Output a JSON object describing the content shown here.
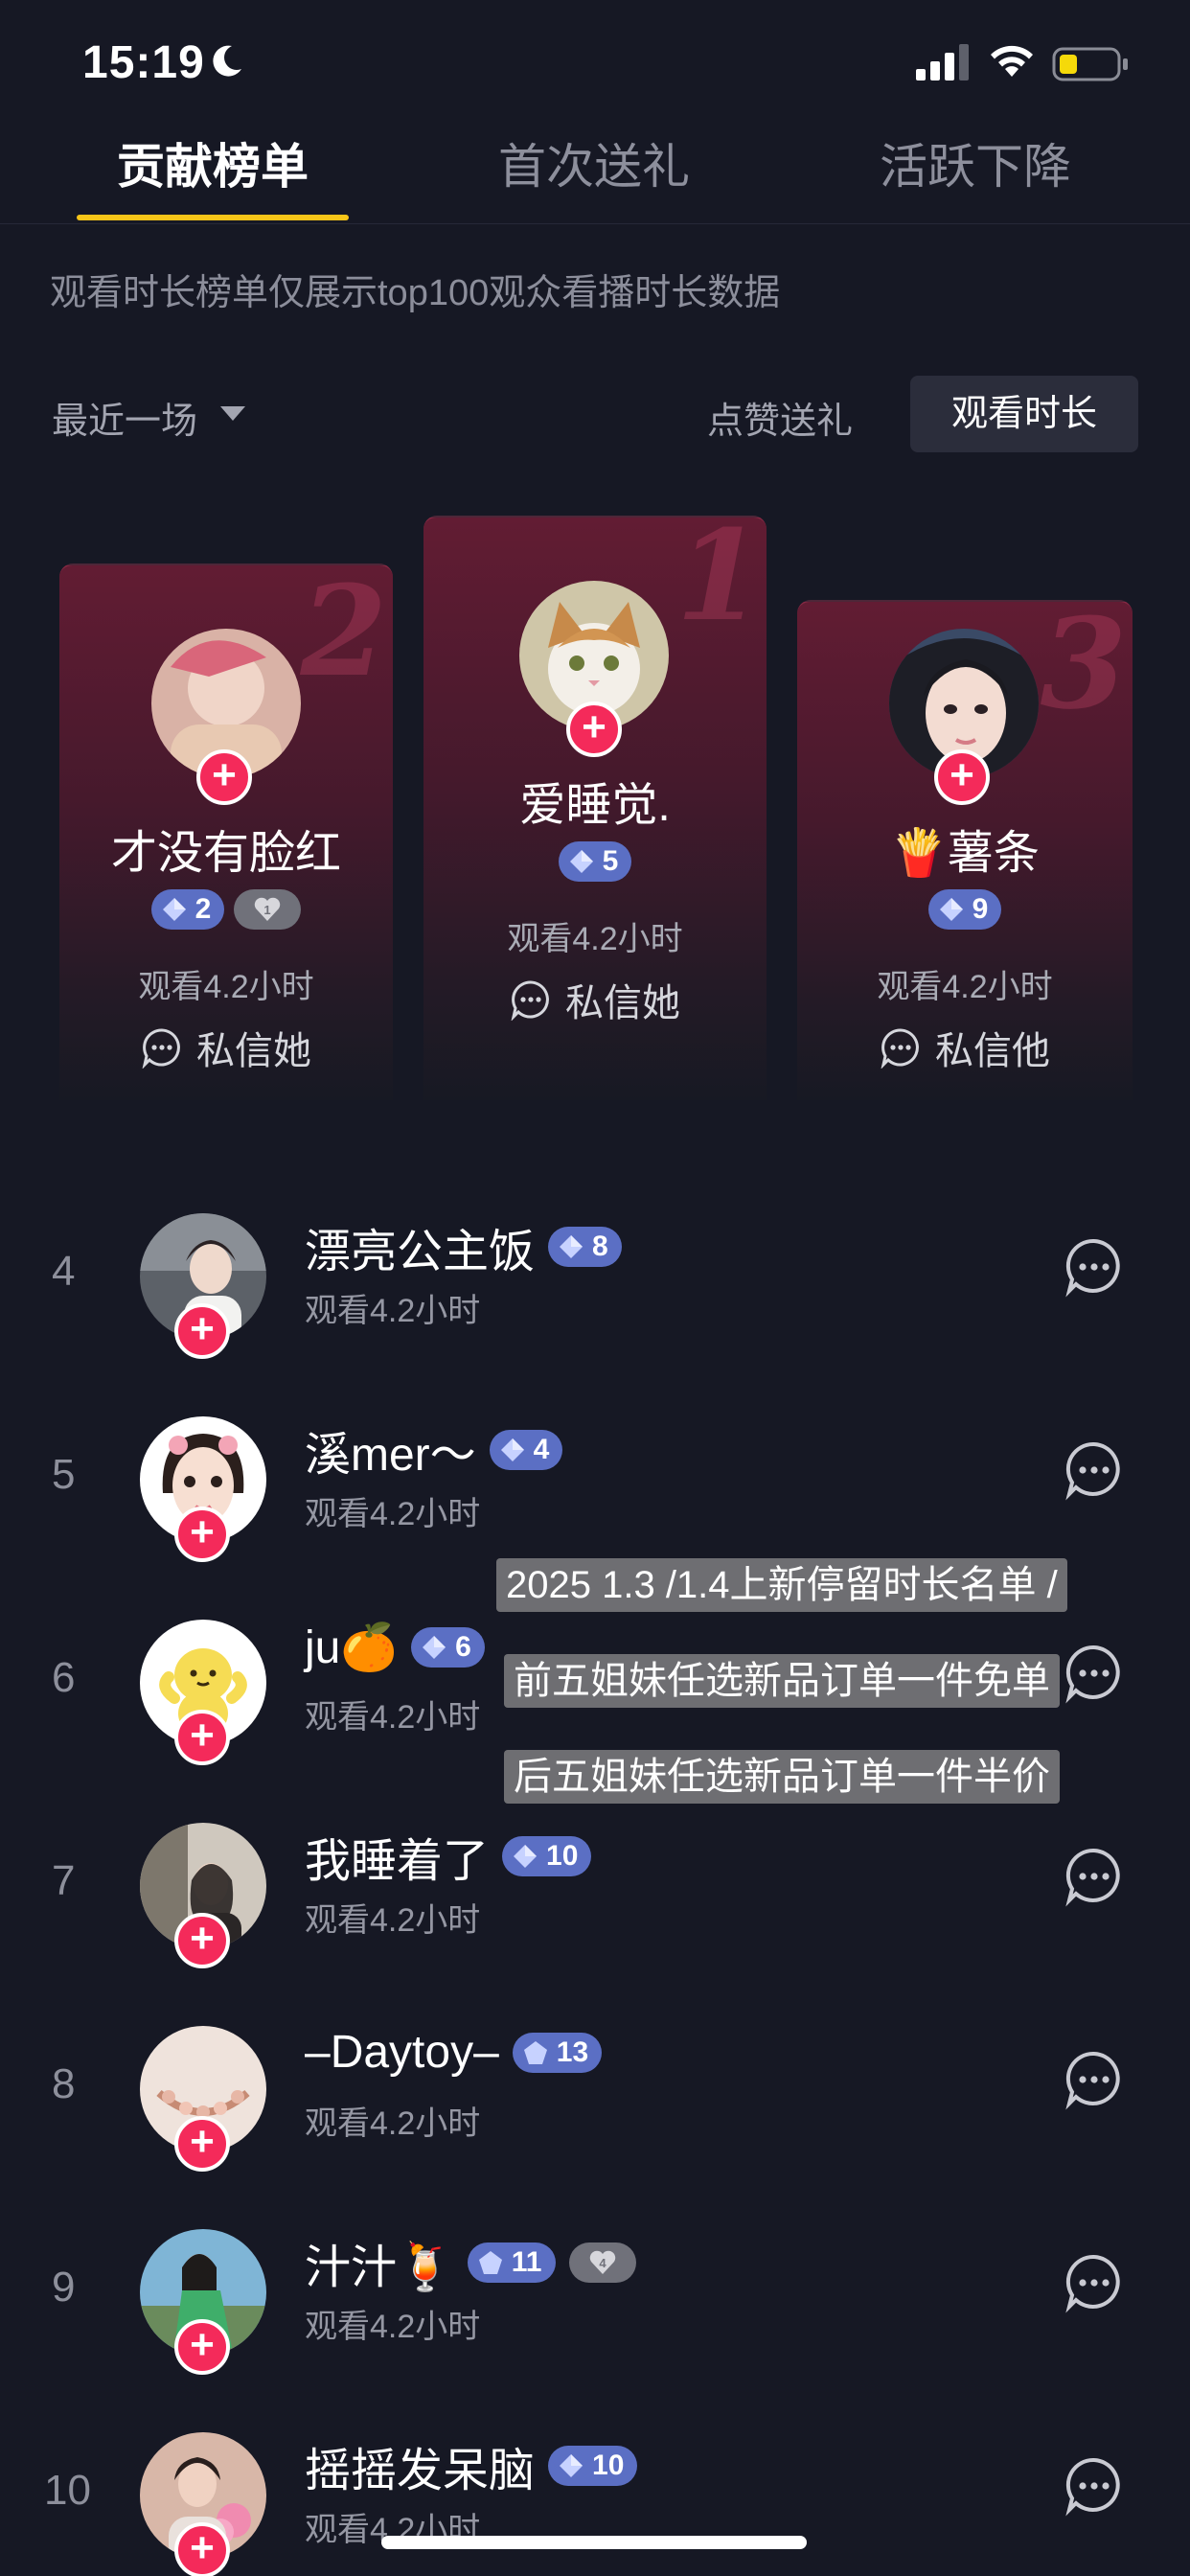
{
  "status_bar": {
    "time": "15:19"
  },
  "tabs": [
    {
      "label": "贡献榜单",
      "active": true
    },
    {
      "label": "首次送礼",
      "active": false
    },
    {
      "label": "活跃下降",
      "active": false
    }
  ],
  "notice": "观看时长榜单仅展示top100观众看播时长数据",
  "filter": {
    "period": "最近一场",
    "sort_likes": "点赞送礼",
    "sort_watch": "观看时长"
  },
  "podium": [
    {
      "rank": "2",
      "name": "才没有脸红",
      "level": "2",
      "fan_level": "1",
      "watch": "观看4.2小时",
      "dm": "私信她"
    },
    {
      "rank": "1",
      "name": "爱睡觉.",
      "level": "5",
      "watch": "观看4.2小时",
      "dm": "私信她"
    },
    {
      "rank": "3",
      "name": "🍟薯条",
      "level": "9",
      "watch": "观看4.2小时",
      "dm": "私信他"
    }
  ],
  "list": [
    {
      "rank": "4",
      "name": "漂亮公主饭",
      "level": "8",
      "watch": "观看4.2小时"
    },
    {
      "rank": "5",
      "name": "溪mer～",
      "level": "4",
      "watch": "观看4.2小时"
    },
    {
      "rank": "6",
      "name": "ju🍊",
      "level": "6",
      "watch": "观看4.2小时"
    },
    {
      "rank": "7",
      "name": "我睡着了",
      "level": "10",
      "watch": "观看4.2小时"
    },
    {
      "rank": "8",
      "name": "–Daytoy–",
      "level": "13",
      "watch": "观看4.2小时"
    },
    {
      "rank": "9",
      "name": "汁汁🍹",
      "level": "11",
      "fan_level": "4",
      "watch": "观看4.2小时"
    },
    {
      "rank": "10",
      "name": "摇摇发呆脑",
      "level": "10",
      "watch": "观看4.2小时"
    }
  ],
  "overlay": [
    "2025 1.3 /1.4上新停留时长名单 /",
    "前五姐妹任选新品订单一件免单",
    "后五姐妹任选新品订单一件半价"
  ],
  "colors": {
    "background": "#161824",
    "tab_accent": "#f7c518",
    "plus": "#f42a5a",
    "level_badge": "#5b6fc4"
  }
}
